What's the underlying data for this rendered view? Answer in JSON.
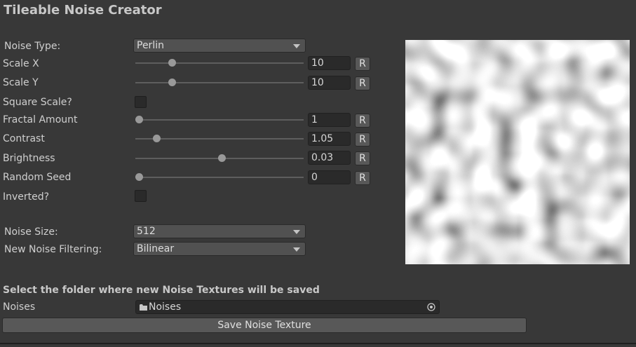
{
  "window": {
    "title": "Tileable Noise Creator"
  },
  "noise_type": {
    "label": "Noise Type:",
    "value": "Perlin"
  },
  "sliders": [
    {
      "label": "Scale X",
      "value": "10",
      "fraction": 0.205,
      "reset": "R"
    },
    {
      "label": "Scale Y",
      "value": "10",
      "fraction": 0.205,
      "reset": "R"
    },
    {
      "label": "Fractal Amount",
      "value": "1",
      "fraction": 0.0,
      "reset": "R"
    },
    {
      "label": "Contrast",
      "value": "1.05",
      "fraction": 0.11,
      "reset": "R"
    },
    {
      "label": "Brightness",
      "value": "0.03",
      "fraction": 0.515,
      "reset": "R"
    },
    {
      "label": "Random Seed",
      "value": "0",
      "fraction": 0.0,
      "reset": "R"
    }
  ],
  "square_scale": {
    "label": "Square Scale?",
    "checked": false
  },
  "inverted": {
    "label": "Inverted?",
    "checked": false
  },
  "noise_size": {
    "label": "Noise Size:",
    "value": "512"
  },
  "filtering": {
    "label": "New Noise Filtering:",
    "value": "Bilinear"
  },
  "save_section": {
    "heading": "Select the folder where new Noise Textures will be saved",
    "folder_label": "Noises",
    "folder_value": "Noises",
    "save_button": "Save Noise Texture"
  },
  "colors": {
    "background": "#383838",
    "field": "#2a2a2a",
    "button": "#585858",
    "text": "#d2d2d2"
  }
}
